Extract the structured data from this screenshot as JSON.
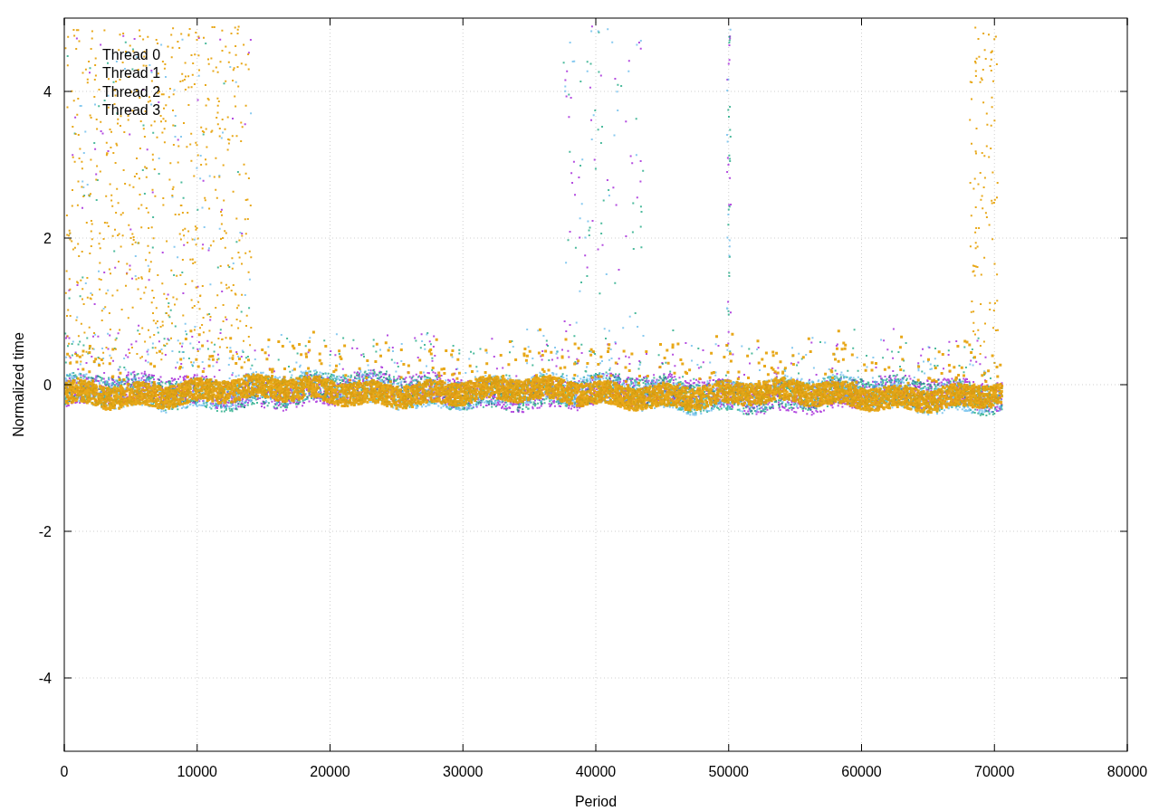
{
  "plot": {
    "x_axis_title": "Period",
    "y_axis_title": "Normalized time",
    "x_tick_labels": [
      "0",
      "10000",
      "20000",
      "30000",
      "40000",
      "50000",
      "60000",
      "70000",
      "80000"
    ],
    "y_tick_labels": [
      "4",
      "2",
      "0",
      "-2",
      "-4"
    ],
    "legend": [
      {
        "label": "Thread 0"
      },
      {
        "label": "Thread 1"
      },
      {
        "label": "Thread 2"
      },
      {
        "label": "Thread 3"
      }
    ]
  }
}
